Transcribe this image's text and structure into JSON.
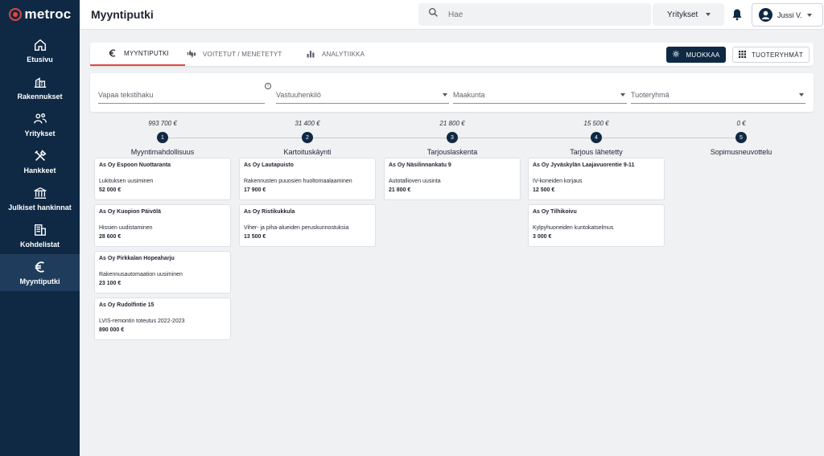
{
  "app": {
    "brand": "metroc"
  },
  "sidebar": {
    "items": [
      {
        "label": "Etusivu",
        "icon": "home-icon",
        "active": false
      },
      {
        "label": "Rakennukset",
        "icon": "building-icon",
        "active": false
      },
      {
        "label": "Yritykset",
        "icon": "people-icon",
        "active": false
      },
      {
        "label": "Hankkeet",
        "icon": "tools-icon",
        "active": false
      },
      {
        "label": "Julkiset hankinnat",
        "icon": "institution-icon",
        "active": false
      },
      {
        "label": "Kohdelistat",
        "icon": "list-building-icon",
        "active": false
      },
      {
        "label": "Myyntiputki",
        "icon": "euro-icon",
        "active": true
      }
    ]
  },
  "header": {
    "title": "Myyntiputki",
    "search_placeholder": "Hae",
    "company_select": "Yritykset",
    "user_name": "Jussi V."
  },
  "tabs": [
    {
      "label": "MYYNTIPUTKI",
      "icon": "euro-icon",
      "active": true
    },
    {
      "label": "VOITETUT / MENETETYT",
      "icon": "thumbs-icon",
      "active": false
    },
    {
      "label": "ANALYTIIKKA",
      "icon": "bar-chart-icon",
      "active": false
    }
  ],
  "actions": {
    "edit": "MUOKKAA",
    "product_groups": "TUOTERYHMÄT"
  },
  "filters": {
    "text_search": "Vapaa tekstihaku",
    "owner": "Vastuuhenkilö",
    "region": "Maakunta",
    "product_group": "Tuoteryhmä"
  },
  "stages": [
    {
      "number": "1",
      "name": "Myyntimahdollisuus",
      "total": "993 700 €",
      "deals": [
        {
          "company": "As Oy Espoon Nuottaranta",
          "description": "Lukituksen uusiminen",
          "amount": "52 000 €"
        },
        {
          "company": "As Oy Kuopion Päivölä",
          "description": "Hissien uudistaminen",
          "amount": "28 600 €"
        },
        {
          "company": "As Oy Pirkkalan Hopeaharju",
          "description": "Rakennusautomaation uusiminen",
          "amount": "23 100 €"
        },
        {
          "company": "As Oy Rudolfintie 15",
          "description": "LVIS-remontin toteutus 2022-2023",
          "amount": "890 000 €"
        }
      ]
    },
    {
      "number": "2",
      "name": "Kartoituskäynti",
      "total": "31 400 €",
      "deals": [
        {
          "company": "As Oy Lautapuisto",
          "description": "Rakennusten puuosien huoltomaalaaminen",
          "amount": "17 900 €"
        },
        {
          "company": "As Oy Ristikukkula",
          "description": "Viher- ja piha-alueiden peruskunnostuksia",
          "amount": "13 500 €"
        }
      ]
    },
    {
      "number": "3",
      "name": "Tarjouslaskenta",
      "total": "21 800 €",
      "deals": [
        {
          "company": "As Oy Näsilinnankatu 9",
          "description": "Autotallioven uusinta",
          "amount": "21 800 €"
        }
      ]
    },
    {
      "number": "4",
      "name": "Tarjous lähetetty",
      "total": "15 500 €",
      "deals": [
        {
          "company": "As Oy Jyväskylän Laajavuorentie 9-11",
          "description": "IV-koneiden korjaus",
          "amount": "12 500 €"
        },
        {
          "company": "As Oy Tilhikoivu",
          "description": "Kylpyhuoneiden kuntokatselmus",
          "amount": "3 000 €"
        }
      ]
    },
    {
      "number": "5",
      "name": "Sopimusneuvottelu",
      "total": "0 €",
      "deals": []
    }
  ],
  "colors": {
    "sidebar": "#0f2944",
    "accent": "#e2463f",
    "background": "#f0f1f3"
  }
}
